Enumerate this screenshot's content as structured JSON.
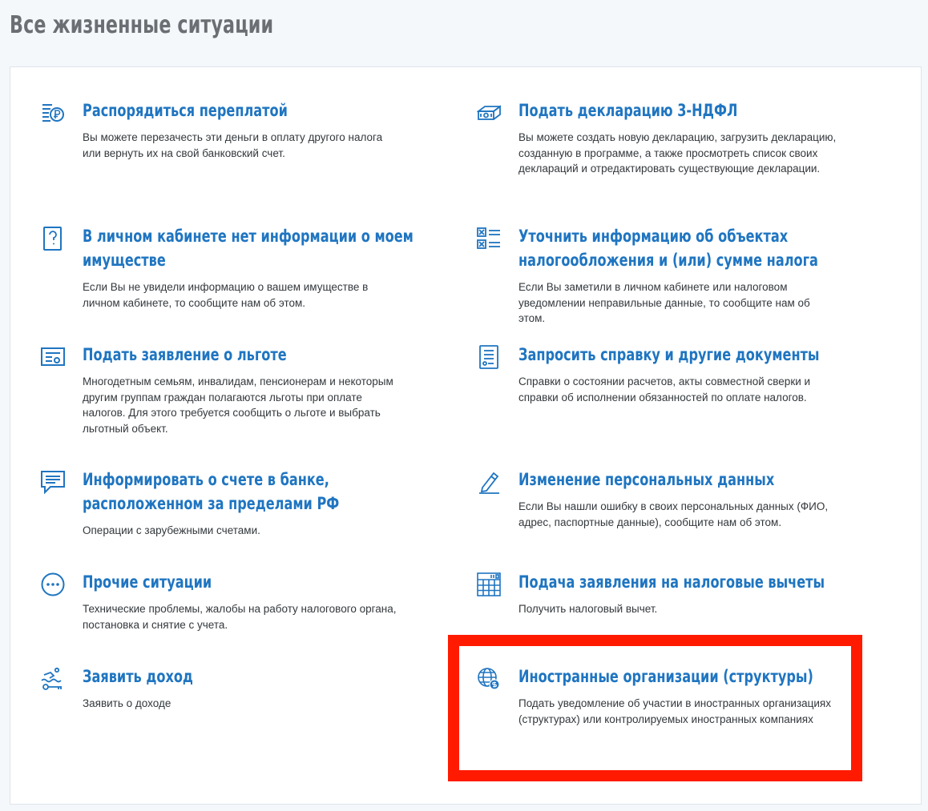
{
  "page": {
    "title": "Все жизненные ситуации"
  },
  "situations": [
    {
      "id": "overpayment",
      "icon": "ruble-coins-icon",
      "title_lines": [
        "Распорядиться переплатой"
      ],
      "description": "Вы можете перезачесть эти деньги в оплату другого налога или вернуть их на свой банковский счет."
    },
    {
      "id": "declaration",
      "icon": "money-stack-icon",
      "title_lines": [
        "Подать декларацию 3-НДФЛ"
      ],
      "description": "Вы можете создать новую декларацию, загрузить декларацию, созданную в программе, а также просмотреть список своих деклараций и отредактировать существующие декларации."
    },
    {
      "id": "no-property-info",
      "icon": "question-document-icon",
      "title_lines": [
        "В личном кабинете нет информации о моем",
        "имуществе"
      ],
      "description": "Если Вы не увидели информацию о вашем имуществе в личном кабинете, то сообщите нам об этом."
    },
    {
      "id": "clarify-objects",
      "icon": "checklist-icon",
      "title_lines": [
        "Уточнить информацию об объектах",
        "налогообложения и (или) сумме налога"
      ],
      "description": "Если Вы заметили в личном кабинете или налоговом уведомлении неправильные данные, то сообщите нам об этом."
    },
    {
      "id": "benefit",
      "icon": "certificate-icon",
      "title_lines": [
        "Подать заявление о льготе"
      ],
      "description": "Многодетным семьям, инвалидам, пенсионерам и некоторым другим группам граждан полагаются льготы при оплате налогов. Для этого требуется сообщить о льготе и выбрать льготный объект."
    },
    {
      "id": "request-documents",
      "icon": "document-list-icon",
      "title_lines": [
        "Запросить справку и другие документы"
      ],
      "description": "Справки о состоянии расчетов, акты совместной сверки и справки об исполнении обязанностей по оплате налогов."
    },
    {
      "id": "foreign-account",
      "icon": "chat-message-icon",
      "title_lines": [
        "Информировать о счете в банке,",
        "расположенном за пределами РФ"
      ],
      "description": "Операции с зарубежными счетами."
    },
    {
      "id": "personal-data",
      "icon": "pencil-icon",
      "title_lines": [
        "Изменение персональных данных"
      ],
      "description": "Если Вы нашли ошибку в своих персональных данных (ФИО, адрес, паспортные данные), сообщите нам об этом."
    },
    {
      "id": "other",
      "icon": "more-dots-icon",
      "title_lines": [
        "Прочие ситуации"
      ],
      "description": "Технические проблемы, жалобы на работу налогового органа, постановка и снятие с учета."
    },
    {
      "id": "tax-deductions",
      "icon": "calculator-icon",
      "title_lines": [
        "Подача заявления на налоговые вычеты"
      ],
      "description": "Получить налоговый вычет."
    },
    {
      "id": "declare-income",
      "icon": "swimmer-key-icon",
      "title_lines": [
        "Заявить доход"
      ],
      "description": "Заявить о доходе"
    },
    {
      "id": "foreign-organizations",
      "icon": "globe-money-icon",
      "title_lines": [
        "Иностранные организации (структуры)"
      ],
      "description": "Подать уведомление об участии в иностранных организациях (структурах) или контролируемых иностранных компаниях"
    }
  ],
  "colors": {
    "accent": "#1f75c1",
    "highlight": "#ff1a00",
    "title": "#6b6f73",
    "text": "#33383c"
  }
}
